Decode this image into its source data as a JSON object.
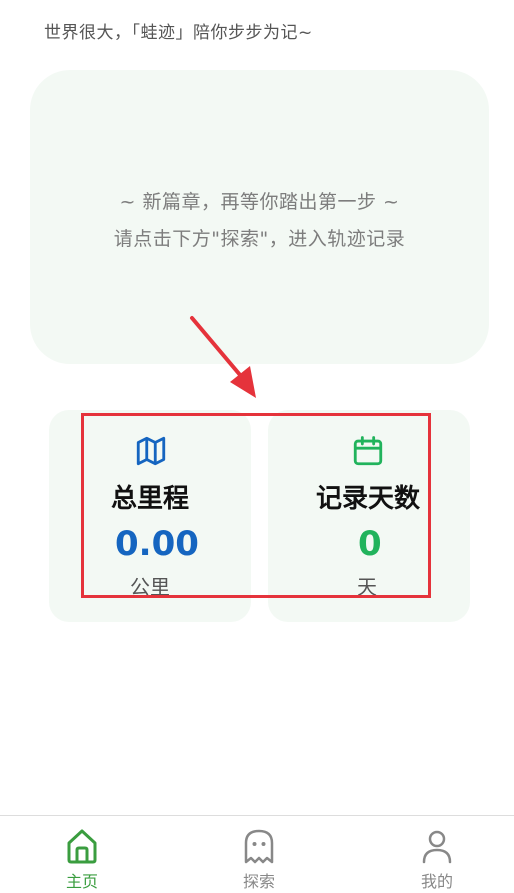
{
  "header": {
    "tagline": "世界很大，「蛙迹」陪你步步为记~"
  },
  "hero": {
    "line1": "~ 新篇章，再等你踏出第一步 ~",
    "line2": "请点击下方\"探索\"，进入轨迹记录"
  },
  "stats": {
    "distance": {
      "icon": "map-icon",
      "label": "总里程",
      "value": "0.00",
      "unit": "公里",
      "color": "#1565c0"
    },
    "days": {
      "icon": "calendar-icon",
      "label": "记录天数",
      "value": "0",
      "unit": "天",
      "color": "#21b35c"
    }
  },
  "annotation": {
    "color": "#e5333b"
  },
  "tabbar": {
    "active_color": "#3a9d3f",
    "inactive_color": "#888888",
    "items": [
      {
        "icon": "home-icon",
        "label": "主页",
        "active": true
      },
      {
        "icon": "ghost-icon",
        "label": "探索",
        "active": false
      },
      {
        "icon": "user-icon",
        "label": "我的",
        "active": false
      }
    ]
  }
}
